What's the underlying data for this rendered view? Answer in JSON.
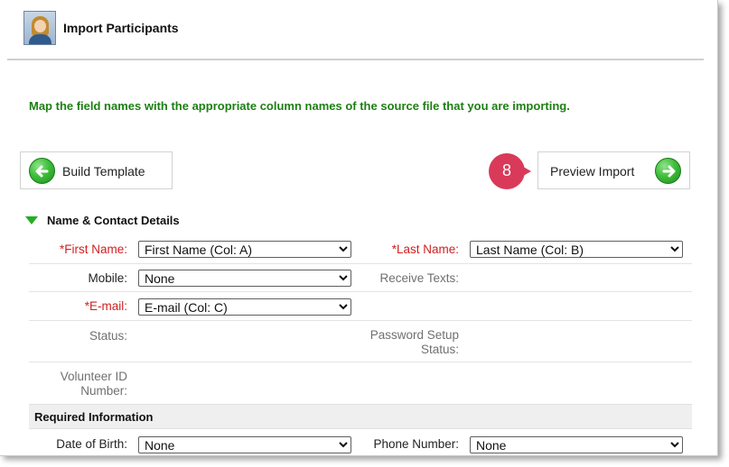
{
  "header": {
    "title": "Import Participants",
    "avatar_icon": "participant-avatar-icon"
  },
  "instructions": "Map the field names with the appropriate column names of the source file that you are importing.",
  "nav": {
    "build_template": "Build Template",
    "preview_import": "Preview Import",
    "step_badge": "8"
  },
  "colors": {
    "accent_green": "#1c7f12",
    "required_red": "#d02020",
    "badge": "#d93a59"
  },
  "sections": {
    "name_contact": "Name & Contact Details",
    "required_info": "Required Information"
  },
  "fields": {
    "first_name": {
      "label": "*First Name:",
      "value": "First Name (Col: A)"
    },
    "last_name": {
      "label": "*Last Name:",
      "value": "Last Name (Col: B)"
    },
    "mobile": {
      "label": "Mobile:",
      "value": "None"
    },
    "receive_texts": {
      "label": "Receive Texts:"
    },
    "email": {
      "label": "*E-mail:",
      "value": "E-mail (Col: C)"
    },
    "status": {
      "label": "Status:"
    },
    "password_setup_1": "Password Setup",
    "password_setup_2": "Status:",
    "volunteer_id_1": "Volunteer ID",
    "volunteer_id_2": "Number:",
    "date_of_birth": {
      "label": "Date of Birth:",
      "value": "None"
    },
    "phone_number": {
      "label": "Phone Number:",
      "value": "None"
    }
  }
}
